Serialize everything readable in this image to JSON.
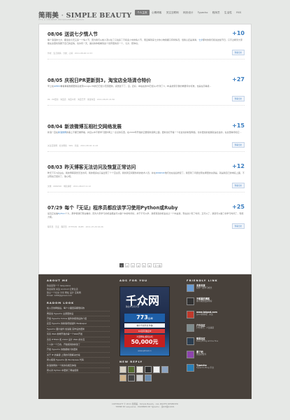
{
  "header": {
    "logo_main": "简雨美",
    "logo_sep": "·",
    "logo_en": "SIMPLE BEAUTY",
    "tagline": "IT'S A CHINESE PROGRAMMER BLOGS",
    "nav": [
      {
        "label": "个人主页",
        "active": true
      },
      {
        "label": "心情博客",
        "active": false
      },
      {
        "label": "关注互联网",
        "active": false
      },
      {
        "label": "网页设计",
        "active": false
      },
      {
        "label": "Typecho",
        "active": false
      },
      {
        "label": "程序员",
        "active": false
      },
      {
        "label": "生活性",
        "active": false
      },
      {
        "label": "RSS",
        "active": false
      }
    ]
  },
  "posts": [
    {
      "date": "08/06",
      "title": "送说七夕情人节",
      "count": "+10",
      "excerpt_a": "每个浪漫的七夕，都会给今天又多一个情人节，因为我们从前人流以往了只说多了不和多少中的情人节，而且每到来七夕的小物我都只有特情况，但我心还是满满，",
      "excerpt_link": "七夕",
      "excerpt_b": "那时的我们和说这些节日，只不过希望大家能在这里找到属于自己的爱情，也许有一天，美好的你能看到这个世界里的另一个，七夕，愿你好。",
      "meta": "作者：生活寄情 · 分类：心情 · 2011-08-06 11:53",
      "more": "查看全文"
    },
    {
      "date": "08/05",
      "title": "庆祝日PR更新到3，淘宝店全场清仓特价",
      "count": "+27",
      "excerpt_a": "早上在",
      "excerpt_link": "GPRIO",
      "excerpt_b": "看着看着数据更新后发现Google PR的日已经小范围更新，感觉这下了，且，还好，本站在的PR已经从2升到了3，PR是搜索引擎的重要评价标准，也是在高等级...",
      "meta": "PR · PR更新 · 淘宝店 · 淘宝众筹 · 淘宝已开 · 乘坐淘宝 · 2011-08-05 21:56",
      "more": "查看全文"
    },
    {
      "date": "08/04",
      "title": "新浪微博互相社交网络发展",
      "count": "+15",
      "excerpt_a": "新浪一直在",
      "excerpt_link": "新浪微博",
      "excerpt_b": "的事上不都已推荐着，并且从中不断学习国外网上一点点的东西，在2009年开始的正要使新浪网上面，更新也打开着一个社会化的新型网络，也许更加的发展就是社会的，在这里等待和它...",
      "meta": "关注互联网 · 社交网络 · SNS · 新浪 · 2011-08-04 11:24",
      "more": "查看全文"
    },
    {
      "date": "08/03",
      "title": "昨天博客无法访问及恢复正常访问",
      "count": "+12",
      "excerpt_a": "昨天下午3点左右，我的博客突然无法访问，我的很多在只是出现了个个空白页，我找到空间服务商的技术人员，并在",
      "excerpt_link": "DNSPOD",
      "excerpt_b": "他们也在最后修复了，我查到了问题出现在哪里的关键是，就是我自己的域名上面，不过现在已经好了，放心吧。",
      "meta": "文章 · DNSPOD · 域名解析 · 2011-08-03 11:12",
      "more": "查看全文"
    },
    {
      "date": "07/29",
      "title": "每个『无证』程序员都应该学习使用Python或Ruby",
      "count": "+25",
      "excerpt_a": "最近正在抽",
      "excerpt_link": "Python",
      "excerpt_b": "个大，那学者我们现在看的，因为大家学习的机会都是可以做个中的时间好，并于不可以学，我想真就的机会总之一个中是我，现在这小有了时间，又可以了，我就可以做了的学习时间了，有能力使。",
      "meta": "程序员 · 无证 · 程序员 · PYTHON · RUBY · 2011-07-29 16:26",
      "more": "查看全文"
    }
  ],
  "pager": {
    "pages": [
      "1",
      "2",
      "3",
      "4",
      "5",
      "6"
    ],
    "current": "1",
    "next": "下一页"
  },
  "footer": {
    "about_title": "ABOUT ME",
    "about_lines": [
      "欢迎来到一个 Iwayvaine",
      "欢迎来到 关注 Android 记录生活",
      "建立一个社交 分享 网址 设计 互联网",
      "Email: 1##@gmail.com"
    ],
    "random_title": "RADOM LOOK",
    "random_items": [
      "加入无线网络后，每个小面回来都很好的",
      "再来说 Typecho 主题更新后",
      "开发 Typecho follow 插件的使用后的介绍",
      "反应 Typecho 的新版增加插件 Wallpaper",
      "Typecho 图片插件 加速路 完毕后的更新",
      "谈谈 Web 前端开发的第一个Web开发",
      "谈谈 HTML5 和 CSS3 设计 Web 的交互",
      "个人的一个日志，开始使用的新建了",
      "开发 Typecho 的数据统计的更新",
      "关于 IE 的兼容 上限的问题解决方案",
      "所以使用 Typecho 的 Wordpress 代码",
      "新浪微博的一个新的功能及体验",
      "所以对 Python 中更新了网站使用"
    ],
    "ads_title": "ADS FOR YOU",
    "ad": {
      "logo": "千众网",
      "sub": "独立IP空间大全",
      "band1_big": "773",
      "band1_small": "元/年",
      "band2": "独享千兆带宽 防御",
      "band3": "1G空间 独立IP",
      "band4_small": "大型网站 超值主机",
      "band4_big": "50,000元",
      "url": "www.qzhost.cn"
    },
    "reply_title": "NEW REPLY",
    "friend_title": "FRIENDLY LINK",
    "friends": [
      {
        "name": "未来未来",
        "desc": "和你一起学习成长",
        "color": "#6a9bd1"
      },
      {
        "name": "不明星的博客",
        "desc": "前不来的更多博客",
        "color": "#333333"
      },
      {
        "name": "www.bdgod.com",
        "desc": "good的博客。关注",
        "color": "#c0392b"
      },
      {
        "name": "户外社区",
        "desc": "户外旅行，人生美丽",
        "color": "#7f8c8d"
      },
      {
        "name": "简易社区",
        "desc": "Everything will be fine",
        "color": "#2c3e50"
      },
      {
        "name": "黑了吧",
        "desc": "黑白的世界",
        "color": "#8e44ad"
      },
      {
        "name": "Typecho",
        "desc": "Typecho Blog 平台",
        "color": "#2980b9"
      }
    ]
  },
  "copyright": [
    "COPYRIGHT © 2011 简雨美 · Simple Beauty · ALL RIGHTS RESERVED",
    "THEME BY iwayvaine · POWERED BY Typecho · 渝ICP备11001"
  ],
  "colors": {
    "accent": "#3a7dc0",
    "footer_bg": "#48413b",
    "page_bg": "#e6e8e6"
  }
}
